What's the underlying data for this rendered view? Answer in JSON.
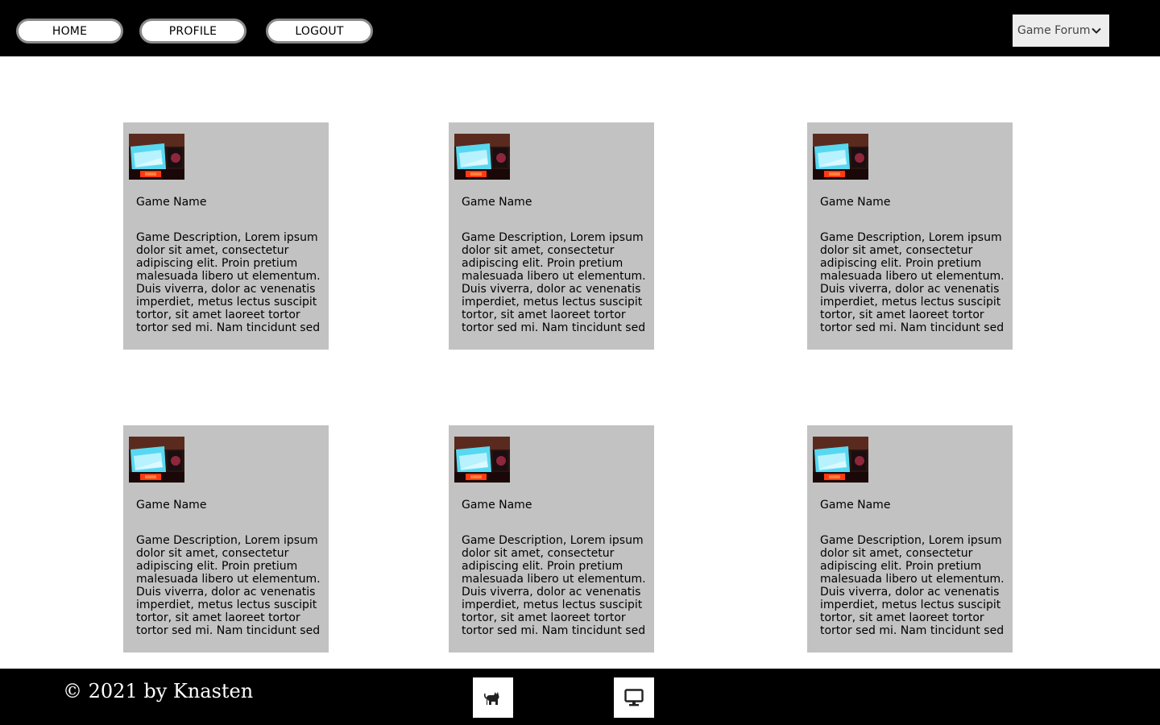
{
  "nav": {
    "home": "HOME",
    "profile": "PROFILE",
    "logout": "LOGOUT"
  },
  "forum_select": {
    "selected": "Game Forum..",
    "icon": "chevron-down-icon"
  },
  "cards": [
    {
      "image": "gaming-monitor-thumbnail",
      "name": "Game Name",
      "description": "Game Description, Lorem ipsum dolor sit amet, consectetur adipiscing elit. Proin pretium malesuada libero ut elementum. Duis viverra, dolor ac venenatis imperdiet, metus lectus suscipit tortor, sit amet laoreet tortor tortor sed mi. Nam tincidunt sed"
    },
    {
      "image": "gaming-monitor-thumbnail",
      "name": "Game Name",
      "description": "Game Description, Lorem ipsum dolor sit amet, consectetur adipiscing elit. Proin pretium malesuada libero ut elementum. Duis viverra, dolor ac venenatis imperdiet, metus lectus suscipit tortor, sit amet laoreet tortor tortor sed mi. Nam tincidunt sed"
    },
    {
      "image": "gaming-monitor-thumbnail",
      "name": "Game Name",
      "description": "Game Description, Lorem ipsum dolor sit amet, consectetur adipiscing elit. Proin pretium malesuada libero ut elementum. Duis viverra, dolor ac venenatis imperdiet, metus lectus suscipit tortor, sit amet laoreet tortor tortor sed mi. Nam tincidunt sed"
    },
    {
      "image": "gaming-monitor-thumbnail",
      "name": "Game Name",
      "description": "Game Description, Lorem ipsum dolor sit amet, consectetur adipiscing elit. Proin pretium malesuada libero ut elementum. Duis viverra, dolor ac venenatis imperdiet, metus lectus suscipit tortor, sit amet laoreet tortor tortor sed mi. Nam tincidunt sed"
    },
    {
      "image": "gaming-monitor-thumbnail",
      "name": "Game Name",
      "description": "Game Description, Lorem ipsum dolor sit amet, consectetur adipiscing elit. Proin pretium malesuada libero ut elementum. Duis viverra, dolor ac venenatis imperdiet, metus lectus suscipit tortor, sit amet laoreet tortor tortor sed mi. Nam tincidunt sed"
    },
    {
      "image": "gaming-monitor-thumbnail",
      "name": "Game Name",
      "description": "Game Description, Lorem ipsum dolor sit amet, consectetur adipiscing elit. Proin pretium malesuada libero ut elementum. Duis viverra, dolor ac venenatis imperdiet, metus lectus suscipit tortor, sit amet laoreet tortor tortor sed mi. Nam tincidunt sed"
    }
  ],
  "footer": {
    "copyright": "© 2021 by Knasten",
    "icons": [
      "cat-icon",
      "monitor-icon"
    ]
  },
  "colors": {
    "bar": "#000000",
    "card_bg": "#c2c2c2",
    "select_bg": "#ededed"
  }
}
